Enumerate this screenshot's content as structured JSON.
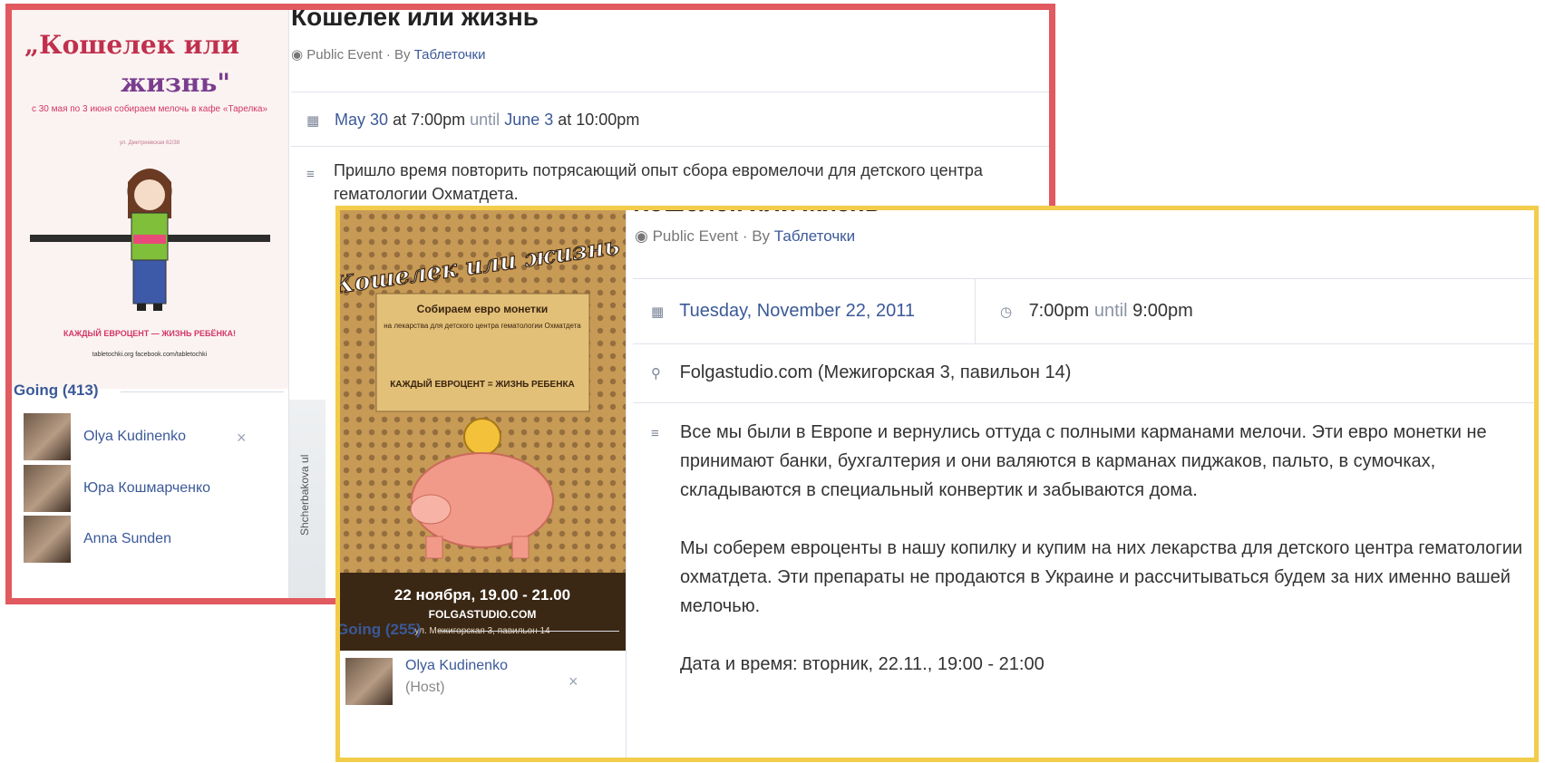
{
  "event1": {
    "title": "Кошелек или жизнь",
    "visibility": "Public Event",
    "by_prefix": "· By",
    "organizer": "Таблеточки",
    "date_start": "May 30",
    "at1": "at 7:00pm",
    "until": "until",
    "date_end": "June 3",
    "at2": "at 10:00pm",
    "description": "Пришло время повторить потрясающий опыт сбора евромелочи для детского центра гематологии Охматдета.",
    "map_label": "Shcherbakova ul",
    "poster": {
      "title_line1": "„Кошелек или",
      "title_line2": "жизнь\"",
      "subtitle": "с 30 мая по 3 июня собираем мелочь в кафе «Тарелка»",
      "address": "ул. Дмитриевская 62/38",
      "slogan": "КАЖДЫЙ ЕВРОЦЕНТ — ЖИЗНЬ РЕБЁНКА!",
      "footer": "tabletochki.org   facebook.com/tabletochki"
    },
    "going_label": "Going (413)",
    "guests": [
      {
        "name": "Olya Kudinenko"
      },
      {
        "name": "Юра Кошмарченко"
      },
      {
        "name": "Anna Sunden"
      }
    ],
    "remove_symbol": "×"
  },
  "event2": {
    "title": "Кошелек или жизнь",
    "visibility": "Public Event",
    "by_prefix": "· By",
    "organizer": "Таблеточки",
    "date": "Tuesday, November 22, 2011",
    "time_start": "7:00pm",
    "until": "until",
    "time_end": "9:00pm",
    "location": "Folgastudio.com (Межигорская 3, павильон 14)",
    "desc_p1": "Все мы были в Европе и вернулись оттуда с полными карманами мелочи. Эти евро монетки не принимают банки, бухгалтерия и они валяются в карманах пиджаков, пальто, в сумочках, складываются в специальный конвертик и забываются дома.",
    "desc_p2": "Мы соберем евроценты в нашу копилку и купим на них лекарства для детского центра гематологии охматдета. Эти препараты не продаются в Украине и рассчитываться будем за них именно вашей мелочью.",
    "desc_p3": "Дата и время: вторник, 22.11., 19:00 - 21:00",
    "poster": {
      "title": "Кошелек или жизнь",
      "box_line1": "Собираем евро монетки",
      "box_line2": "на лекарства для детского центра гематологии Охматдета",
      "box_line3": "КАЖДЫЙ ЕВРОЦЕНТ = ЖИЗНЬ РЕБЕНКА",
      "date": "22 ноября, 19.00 - 21.00",
      "site": "FOLGASTUDIO.COM",
      "address": "ул. Межигорская 3, павильон 14"
    },
    "going_label": "Going (255)",
    "guests": [
      {
        "name": "Olya Kudinenko",
        "role": "(Host)"
      }
    ],
    "remove_symbol": "×"
  },
  "colors": {
    "frame1": "#e05a60",
    "frame2": "#f2cc4a",
    "link": "#3b5998"
  }
}
